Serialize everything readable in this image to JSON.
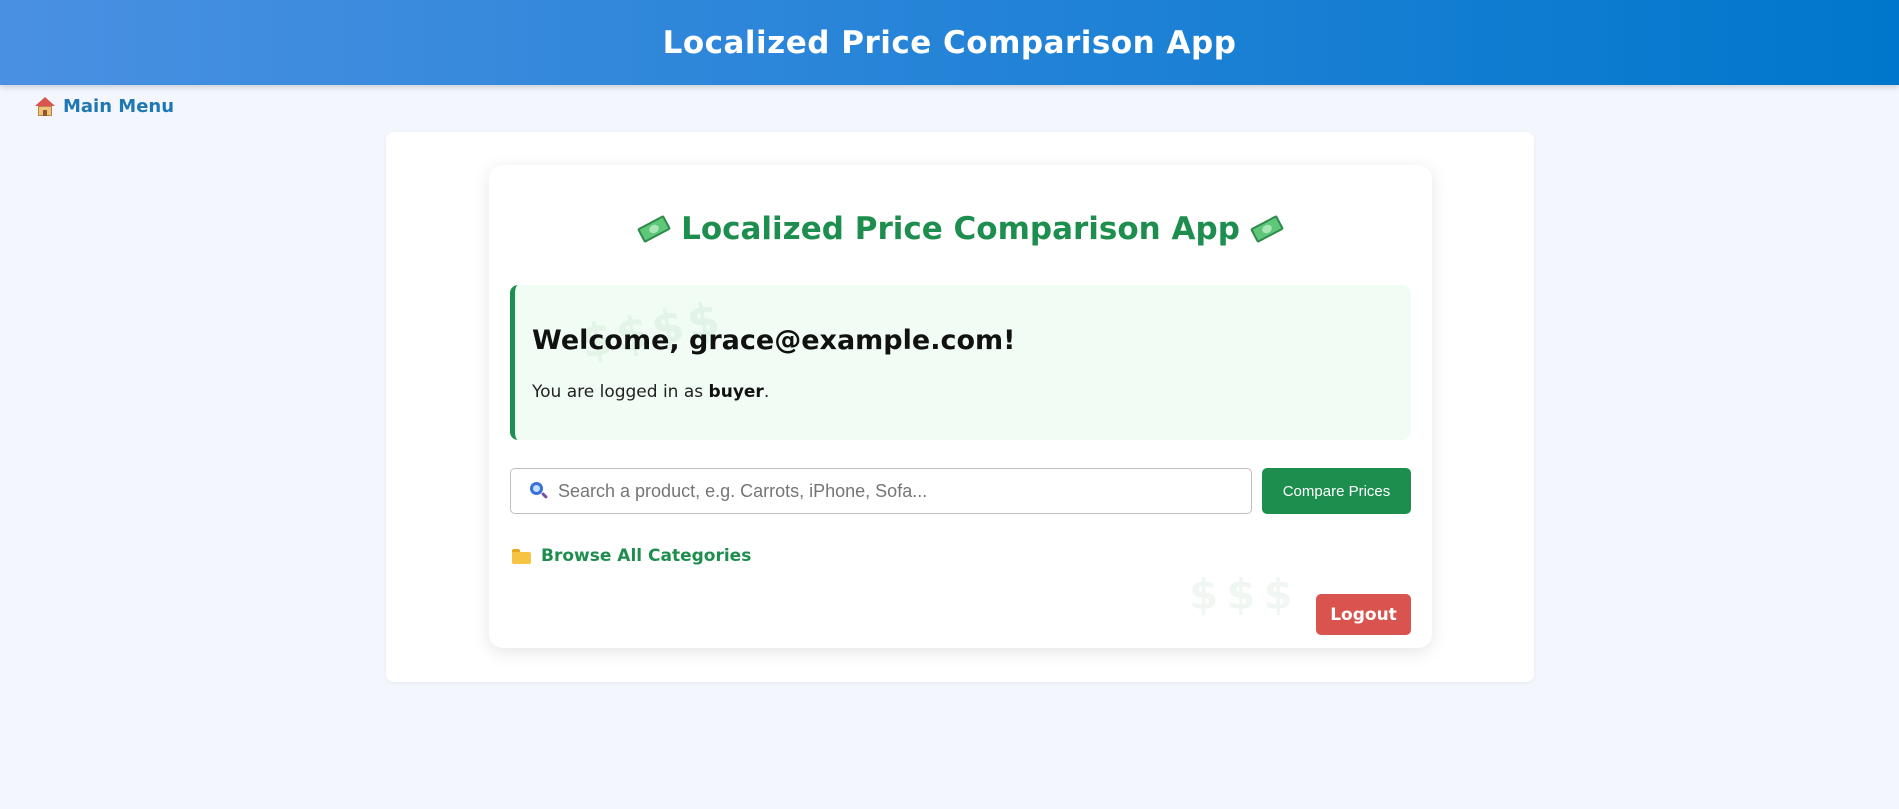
{
  "header": {
    "title": "Localized Price Comparison App"
  },
  "nav": {
    "main_menu_label": "Main Menu",
    "main_menu_icon": "home-icon"
  },
  "card": {
    "heading": "Localized Price Comparison App",
    "heading_icon": "money-with-wings-icon",
    "welcome": {
      "title": "Welcome, grace@example.com!",
      "sub_prefix": "You are logged in as ",
      "role": "buyer",
      "sub_suffix": "."
    },
    "search": {
      "icon": "magnifier-icon",
      "placeholder": "Search a product, e.g. Carrots, iPhone, Sofa...",
      "value": ""
    },
    "compare_label": "Compare Prices",
    "browse_label": "Browse All Categories",
    "browse_icon": "folder-icon",
    "logout_label": "Logout"
  },
  "colors": {
    "header_gradient_start": "#4a90e2",
    "header_gradient_end": "#0077cc",
    "accent_green": "#1e8e4e",
    "link_blue": "#1f78b4",
    "logout_red": "#d9534f",
    "welcome_bg": "#f1fdf4"
  }
}
